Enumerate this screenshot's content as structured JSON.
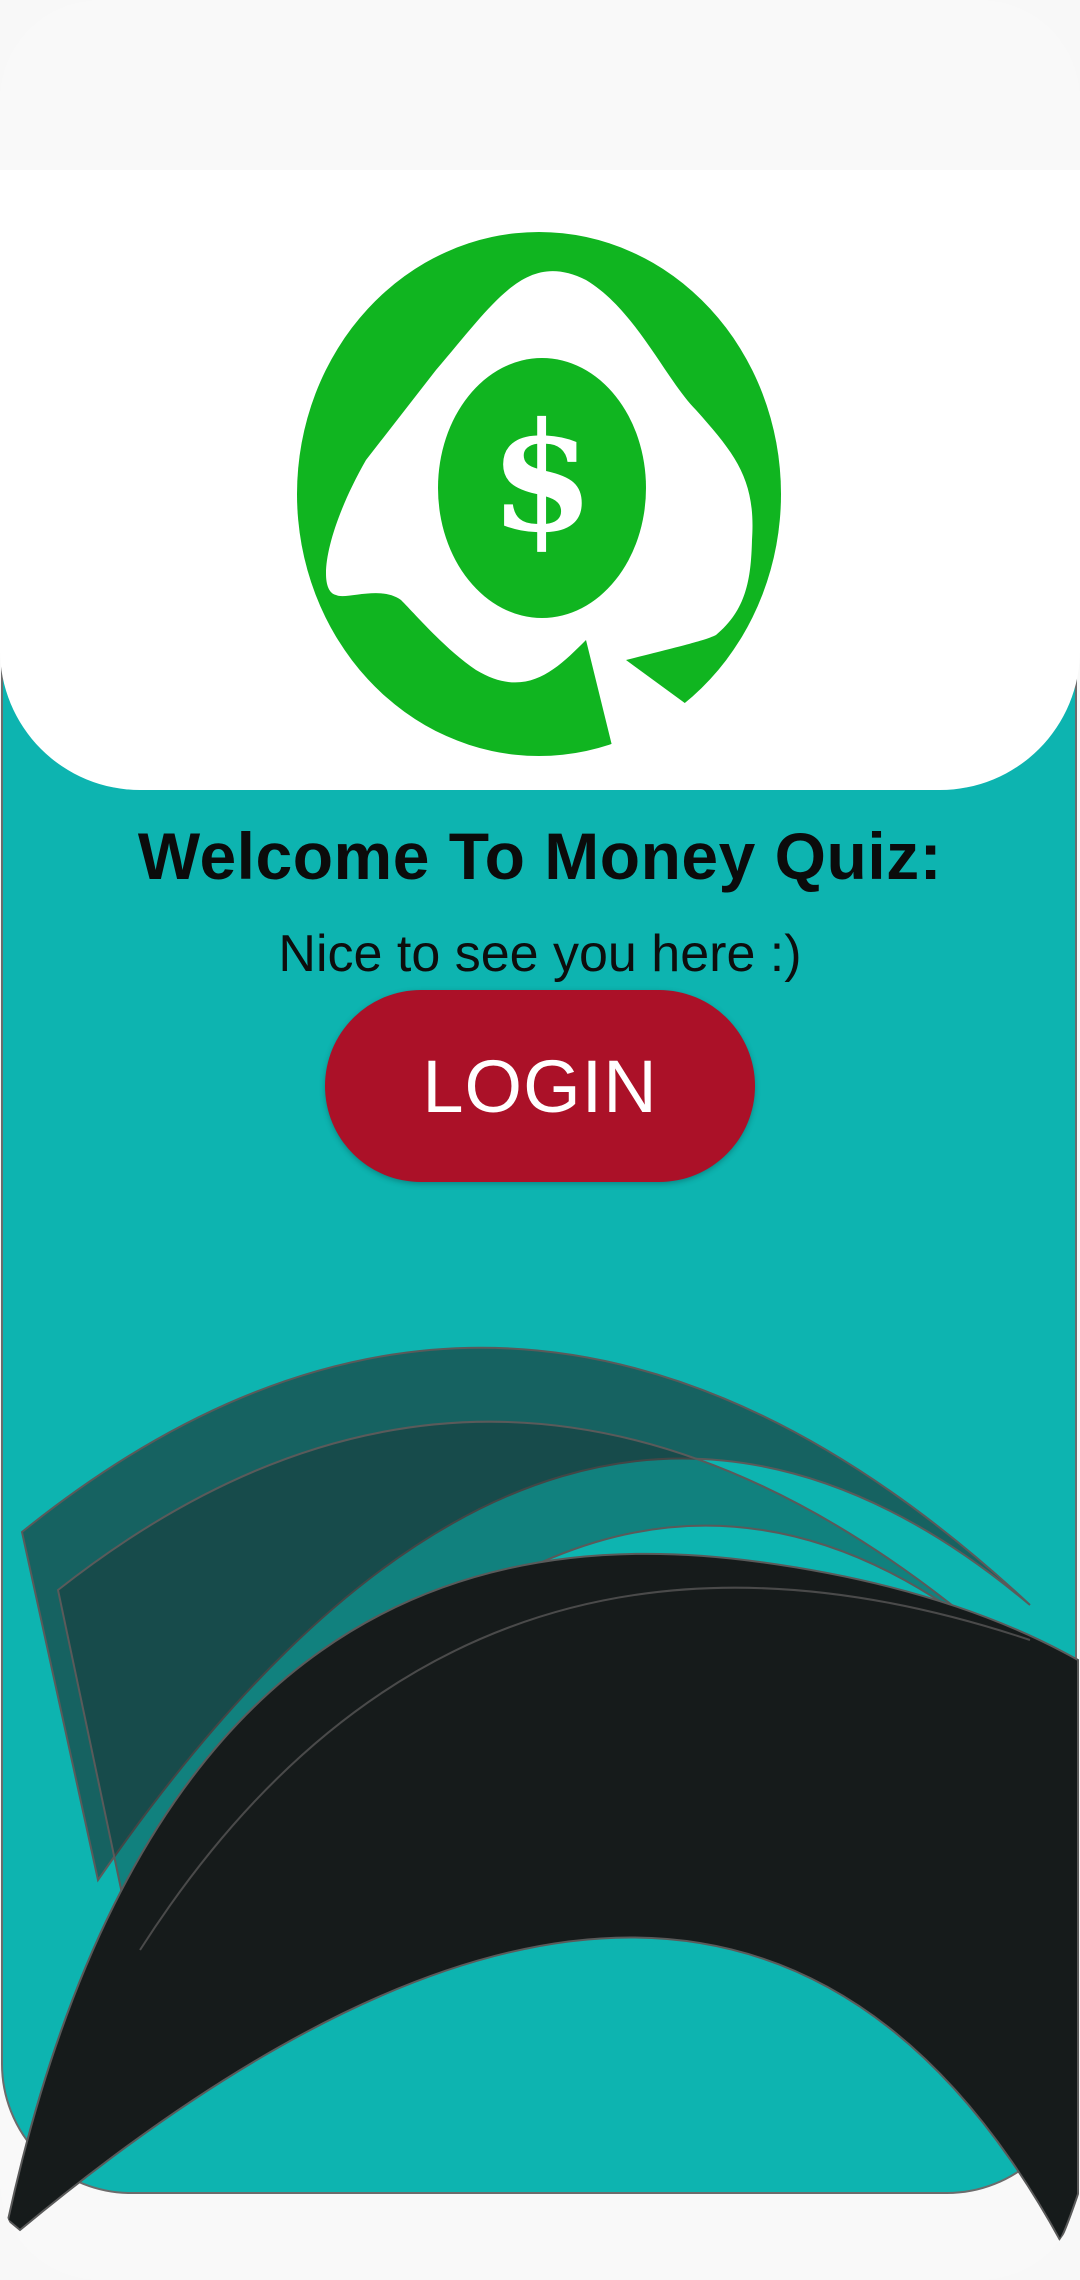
{
  "app": {
    "logo_icon": "money-quiz-logo-icon",
    "logo_symbol": "$"
  },
  "welcome": {
    "title": "Welcome To Money Quiz:",
    "subtitle": "Nice to see you here :)"
  },
  "login": {
    "label": "LOGIN"
  },
  "colors": {
    "background": "#0db4b0",
    "header": "#ffffff",
    "logo_green": "#10b520",
    "login_button": "#ab1128",
    "wave_dark": "#161b1b"
  }
}
